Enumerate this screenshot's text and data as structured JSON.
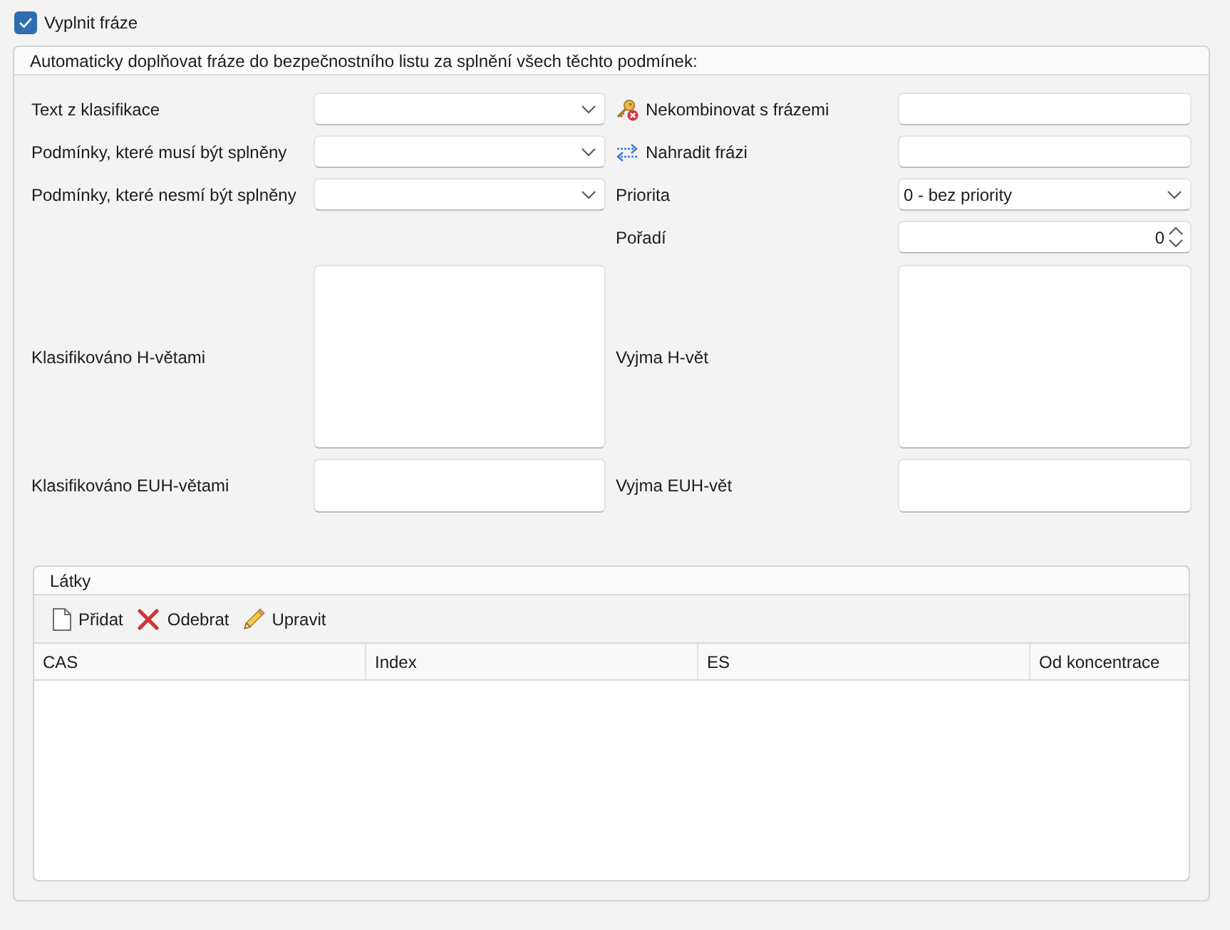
{
  "fill_phrases": {
    "label": "Vyplnit fráze",
    "checked": true
  },
  "rules": {
    "title": "Automaticky doplňovat fráze do bezpečnostního listu za splnění všech těchto podmínek:",
    "left_fields": [
      {
        "label": "Text z klasifikace"
      },
      {
        "label": "Podmínky, které musí být splněny"
      },
      {
        "label": "Podmínky, které nesmí být splněny"
      }
    ],
    "right_fields": [
      {
        "label": "Nekombinovat s frázemi",
        "kind": "text"
      },
      {
        "label": "Nahradit frázi",
        "kind": "text"
      },
      {
        "label": "Priorita",
        "kind": "dropdown",
        "value": "0 - bez priority"
      },
      {
        "label": "Pořadí",
        "kind": "spinner",
        "value": "0"
      }
    ],
    "phrase_lists": [
      {
        "label": "Klasifikováno H-větami",
        "except_label": "Vyjma H-vět"
      },
      {
        "label": "Klasifikováno EUH-větami",
        "except_label": "Vyjma EUH-vět"
      }
    ],
    "substances": {
      "title": "Látky",
      "toolbar": [
        {
          "label": "Přidat"
        },
        {
          "label": "Odebrat"
        },
        {
          "label": "Upravit"
        }
      ],
      "columns": [
        "CAS",
        "Index",
        "ES",
        "Od koncentrace"
      ]
    }
  }
}
